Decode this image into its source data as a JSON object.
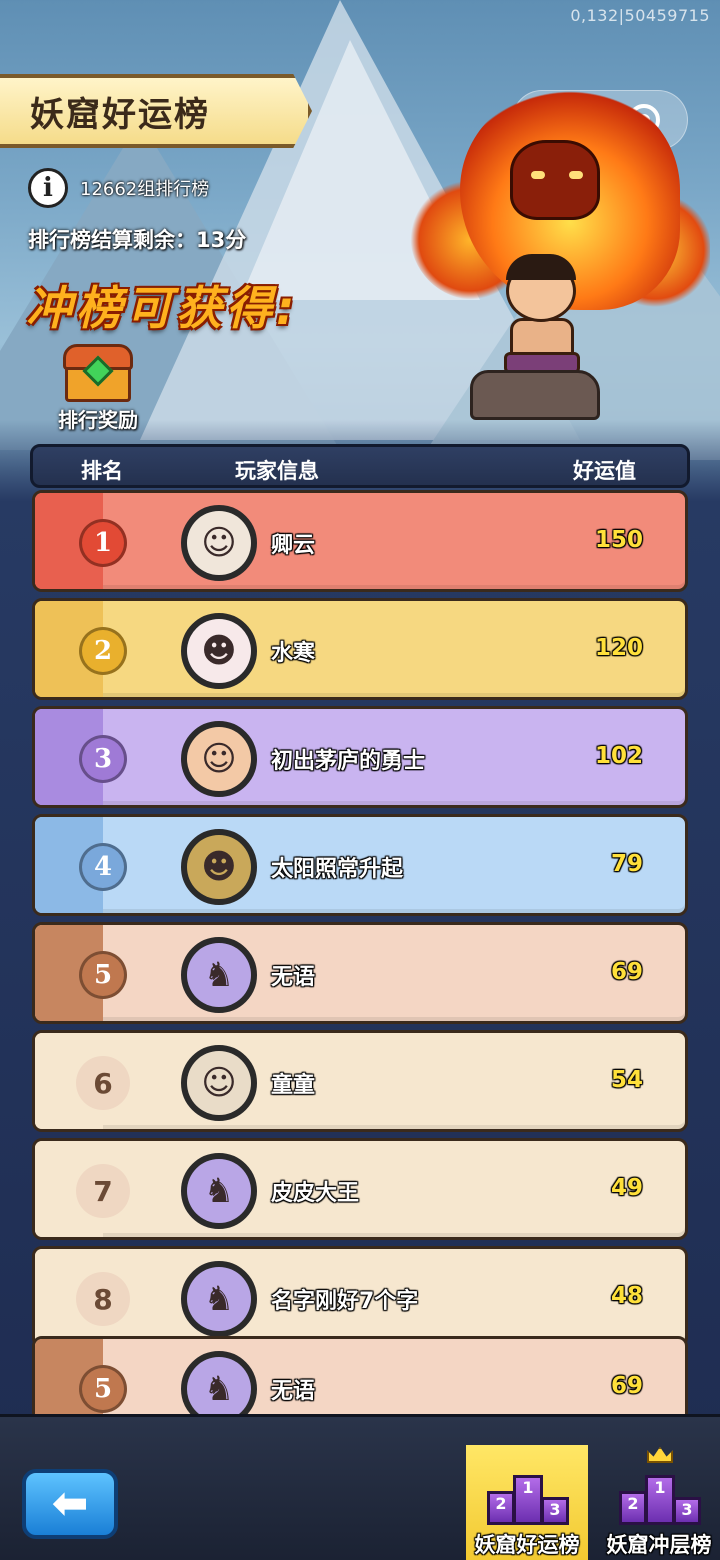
{
  "status": {
    "coords": "0,132|50459715"
  },
  "header": {
    "title": "妖窟好运榜",
    "group_info": "12662组排行榜",
    "countdown": "排行榜结算剩余：13分",
    "promo": "冲榜可获得:",
    "reward_label": "排行奖励"
  },
  "capsule": {
    "more_label": "•••"
  },
  "table": {
    "col_rank": "排名",
    "col_player": "玩家信息",
    "col_luck": "好运值",
    "rows": [
      {
        "rank": "1",
        "name": "卿云",
        "score": "150",
        "row_color": "#f28b7a",
        "strip_color": "#e8604f",
        "medal_color": "#e24a35",
        "avatar_icon": "warrior-avatar"
      },
      {
        "rank": "2",
        "name": "水寒",
        "score": "120",
        "row_color": "#f6d881",
        "strip_color": "#eec157",
        "medal_color": "#e9b02d",
        "avatar_icon": "lucky-cat-avatar"
      },
      {
        "rank": "3",
        "name": "初出茅庐的勇士",
        "score": "102",
        "row_color": "#c9b4f0",
        "strip_color": "#a98be0",
        "medal_color": "#9f7ad6",
        "avatar_icon": "baby-avatar"
      },
      {
        "rank": "4",
        "name": "太阳照常升起",
        "score": "79",
        "row_color": "#bad9f6",
        "strip_color": "#8cb9e6",
        "medal_color": "#7aa8db",
        "avatar_icon": "frog-avatar"
      },
      {
        "rank": "5",
        "name": "无语",
        "score": "69",
        "row_color": "#f4d6c4",
        "strip_color": "#c78660",
        "medal_color": "#c0784f",
        "avatar_icon": "unicorn-avatar"
      },
      {
        "rank": "6",
        "name": "童童",
        "score": "54",
        "row_color": "#f6e7cf",
        "strip_color": "#f6e7cf",
        "medal_color": "",
        "avatar_icon": "elder-avatar"
      },
      {
        "rank": "7",
        "name": "皮皮大王",
        "score": "49",
        "row_color": "#f6e7cf",
        "strip_color": "#f6e7cf",
        "medal_color": "",
        "avatar_icon": "unicorn-avatar"
      },
      {
        "rank": "8",
        "name": "名字刚好7个字",
        "score": "48",
        "row_color": "#f6e7cf",
        "strip_color": "#f6e7cf",
        "medal_color": "",
        "avatar_icon": "unicorn-avatar"
      }
    ],
    "self_row": {
      "rank": "5",
      "name": "无语",
      "score": "69",
      "row_color": "#f4d6c4",
      "strip_color": "#c78660",
      "medal_color": "#c0784f",
      "avatar_icon": "unicorn-avatar"
    }
  },
  "bottom": {
    "tab_luck": "妖窟好运榜",
    "tab_floor": "妖窟冲层榜",
    "podium_1": "1",
    "podium_2": "2",
    "podium_3": "3"
  }
}
